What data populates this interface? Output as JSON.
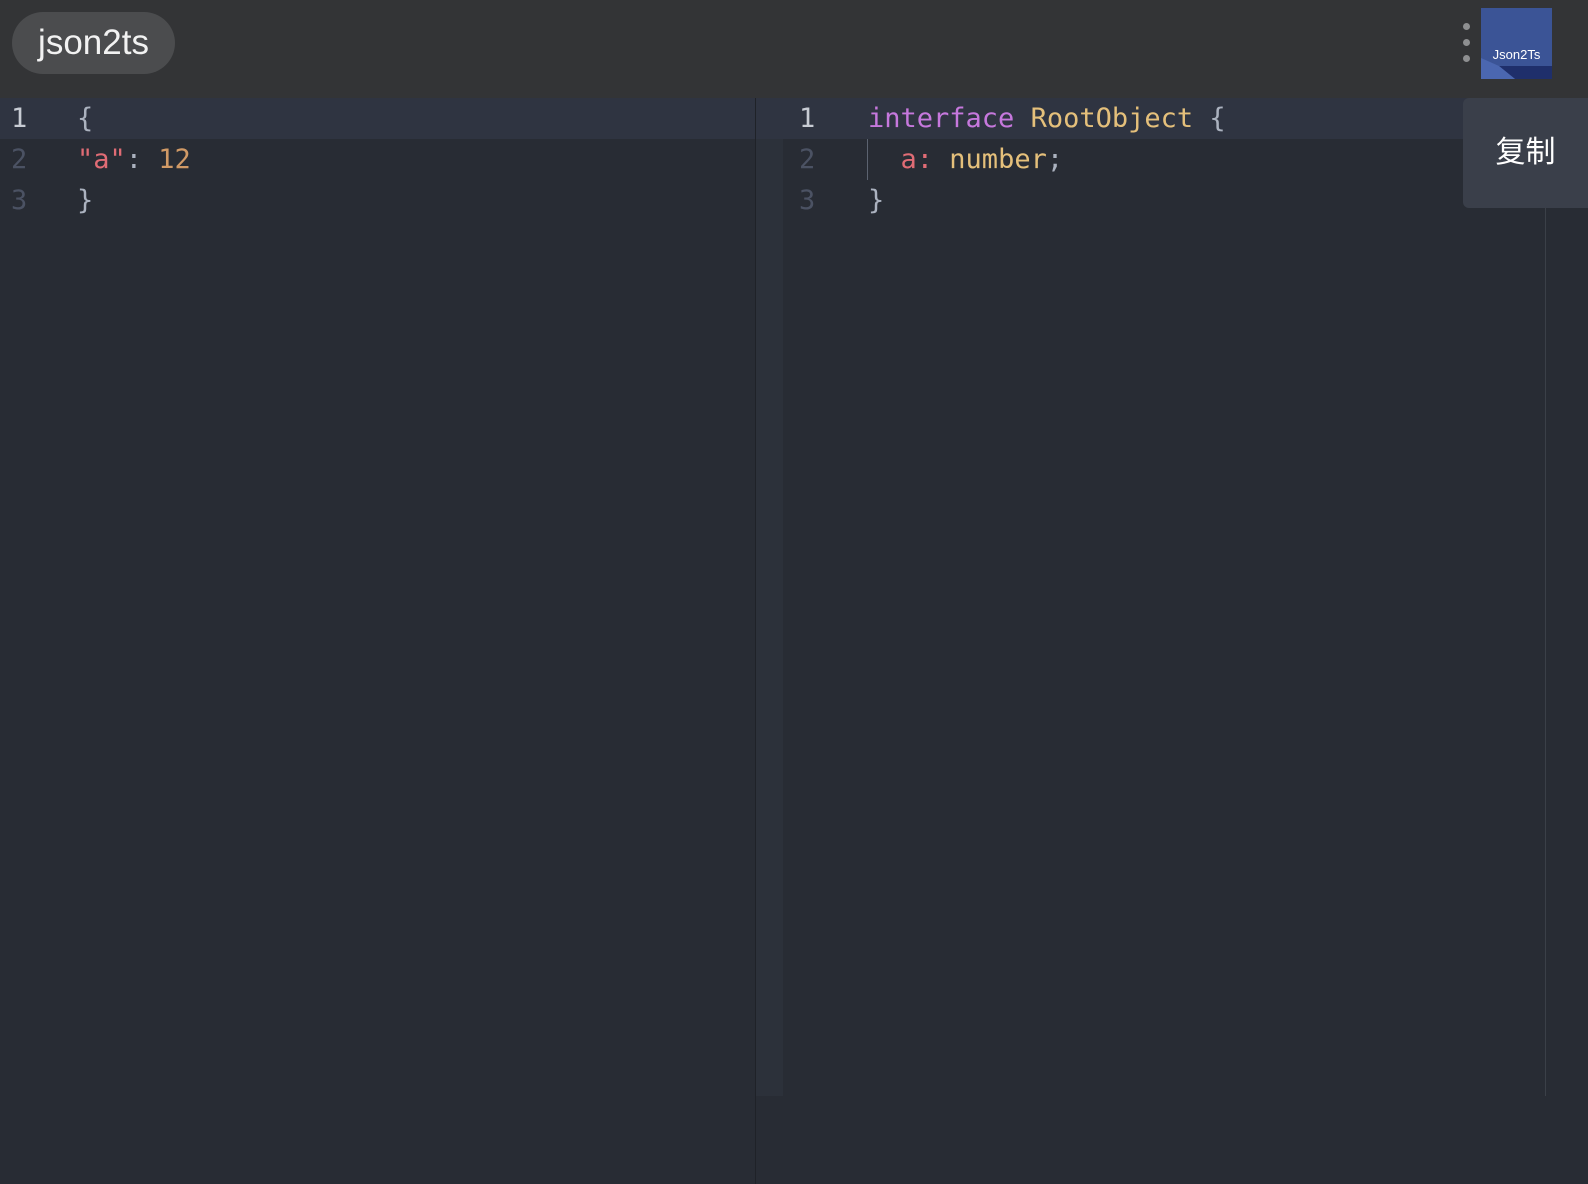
{
  "header": {
    "app_title": "json2ts",
    "menu_icon": "more-vertical-icon",
    "logo_text": "Json2Ts"
  },
  "input_editor": {
    "lines": [
      {
        "number": "1",
        "tokens": [
          {
            "text": "{",
            "kind": "punct"
          }
        ]
      },
      {
        "number": "2",
        "tokens": [
          {
            "text": "\"a\"",
            "kind": "key"
          },
          {
            "text": ": ",
            "kind": "punct"
          },
          {
            "text": "12",
            "kind": "num"
          }
        ]
      },
      {
        "number": "3",
        "tokens": [
          {
            "text": "}",
            "kind": "punct"
          }
        ]
      }
    ]
  },
  "output_editor": {
    "lines": [
      {
        "number": "1",
        "tokens": [
          {
            "text": "interface",
            "kind": "kw"
          },
          {
            "text": " ",
            "kind": "punct"
          },
          {
            "text": "RootObject",
            "kind": "type"
          },
          {
            "text": " {",
            "kind": "punct"
          }
        ]
      },
      {
        "number": "2",
        "tokens": [
          {
            "text": "  ",
            "kind": "punct"
          },
          {
            "text": "a",
            "kind": "key"
          },
          {
            "text": ": ",
            "kind": "key"
          },
          {
            "text": "number",
            "kind": "type"
          },
          {
            "text": ";",
            "kind": "punct"
          }
        ]
      },
      {
        "number": "3",
        "tokens": [
          {
            "text": "}",
            "kind": "punct"
          }
        ]
      }
    ]
  },
  "copy_button": {
    "label": "复制"
  },
  "colors": {
    "background": "#282c34",
    "topbar": "#333436",
    "keyword": "#c678dd",
    "type": "#e5c07b",
    "property": "#e06c75",
    "number": "#d19a66",
    "punctuation": "#abb2bf",
    "logo": "#3b5496"
  }
}
